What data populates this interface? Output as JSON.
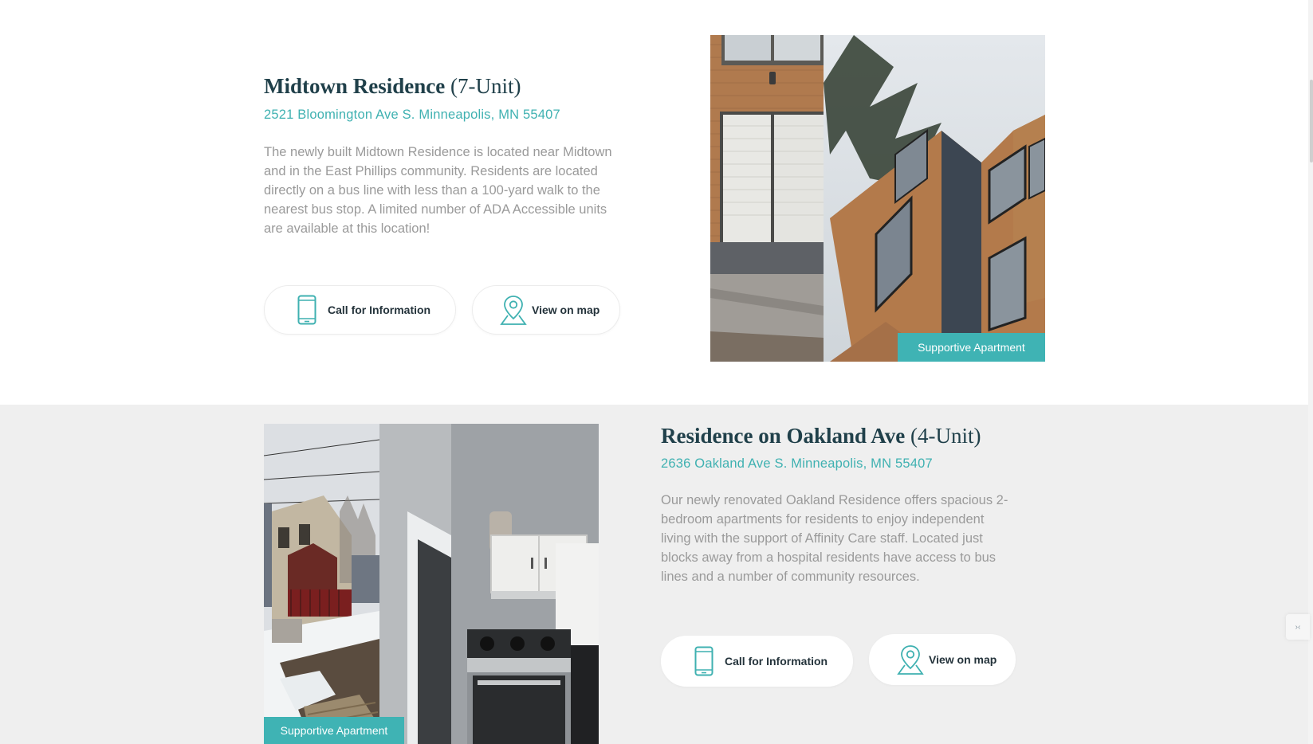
{
  "listings": [
    {
      "name": "Midtown Residence",
      "unit": "(7-Unit)",
      "address": "2521 Bloomington Ave S. Minneapolis, MN 55407",
      "description": "The newly built Midtown Residence is located near Midtown and in the East Phillips community. Residents are located directly on a bus line with less than a 100-yard walk to the nearest bus stop. A limited number of ADA Accessible units are available at this location!",
      "call_label": "Call for Information",
      "map_label": "View on map",
      "badge": "Supportive Apartment"
    },
    {
      "name": "Residence on Oakland Ave",
      "unit": "(4-Unit)",
      "address": "2636 Oakland Ave S. Minneapolis, MN 55407",
      "description": "Our newly renovated Oakland Residence offers spacious 2-bedroom apartments for residents to enjoy independent living with the support of Affinity Care staff. Located just blocks away from a hospital residents have access to bus lines and a number of community resources.",
      "call_label": "Call for Information",
      "map_label": "View on map",
      "badge": "Supportive Apartment"
    }
  ],
  "icons": {
    "phone": "phone-icon",
    "map_pin": "map-pin-icon"
  },
  "colors": {
    "accent": "#3fb1b1",
    "title": "#20404a",
    "body_text": "#9a9a9a",
    "gray_section": "#efefef"
  }
}
